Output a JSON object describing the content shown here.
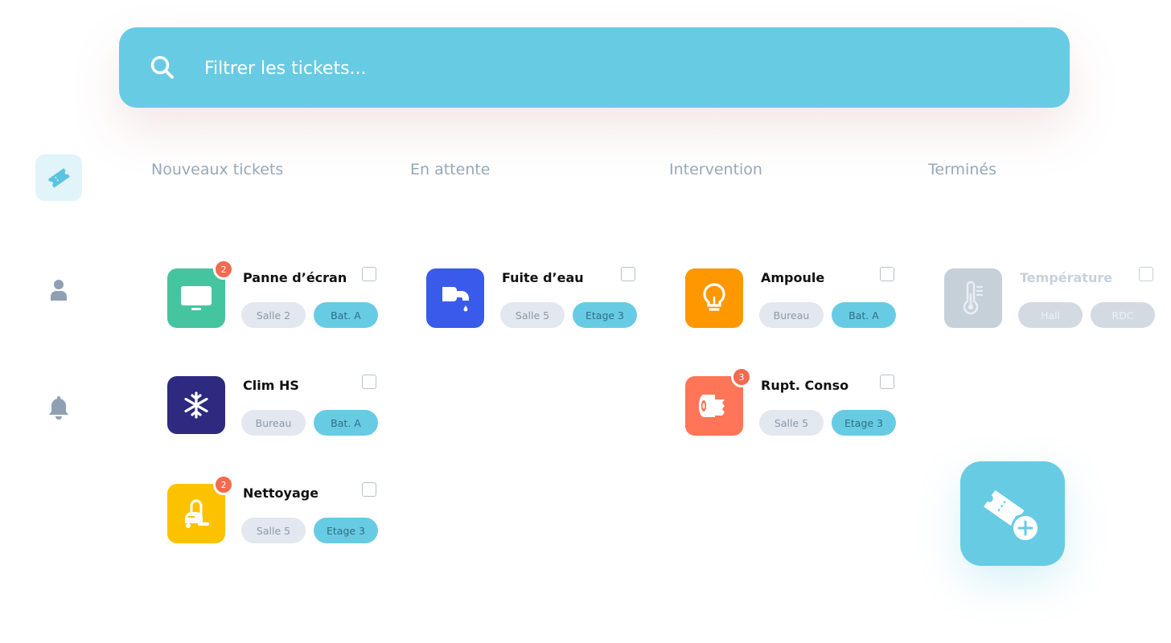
{
  "search": {
    "placeholder": "Filtrer les tickets..."
  },
  "sidebar": {
    "items": [
      {
        "name": "tickets",
        "icon": "ticket-icon",
        "active": true
      },
      {
        "name": "profile",
        "icon": "user-icon",
        "active": false
      },
      {
        "name": "notifications",
        "icon": "bell-icon",
        "active": false
      }
    ]
  },
  "columns": [
    {
      "title": "Nouveaux tickets",
      "cards": [
        {
          "title": "Panne d’écran",
          "icon": "monitor-icon",
          "color": "#45c4a0",
          "badge": "2",
          "tag1": "Salle 2",
          "tag2": "Bat. A"
        },
        {
          "title": "Clim HS",
          "icon": "snowflake-icon",
          "color": "#2d2a80",
          "tag1": "Bureau",
          "tag2": "Bat. A"
        },
        {
          "title": "Nettoyage",
          "icon": "vacuum-icon",
          "color": "#fcc200",
          "badge": "2",
          "tag1": "Salle 5",
          "tag2": "Etage 3"
        }
      ]
    },
    {
      "title": "En attente",
      "cards": [
        {
          "title": "Fuite d’eau",
          "icon": "faucet-icon",
          "color": "#3a5aeb",
          "tag1": "Salle 5",
          "tag2": "Etage 3"
        }
      ]
    },
    {
      "title": "Intervention",
      "cards": [
        {
          "title": "Ampoule",
          "icon": "lightbulb-icon",
          "color": "#ff9700",
          "tag1": "Bureau",
          "tag2": "Bat. A"
        },
        {
          "title": "Rupt. Conso",
          "icon": "toilet-paper-icon",
          "color": "#ff7558",
          "badge": "3",
          "tag1": "Salle 5",
          "tag2": "Etage 3"
        }
      ]
    },
    {
      "title": "Terminés",
      "cards": [
        {
          "title": "Température",
          "icon": "thermometer-icon",
          "color": "#c6d0d8",
          "tag1": "Hall",
          "tag2": "RDC"
        }
      ]
    }
  ],
  "fab": {
    "icon": "add-ticket-icon",
    "color": "#68cbe4"
  }
}
